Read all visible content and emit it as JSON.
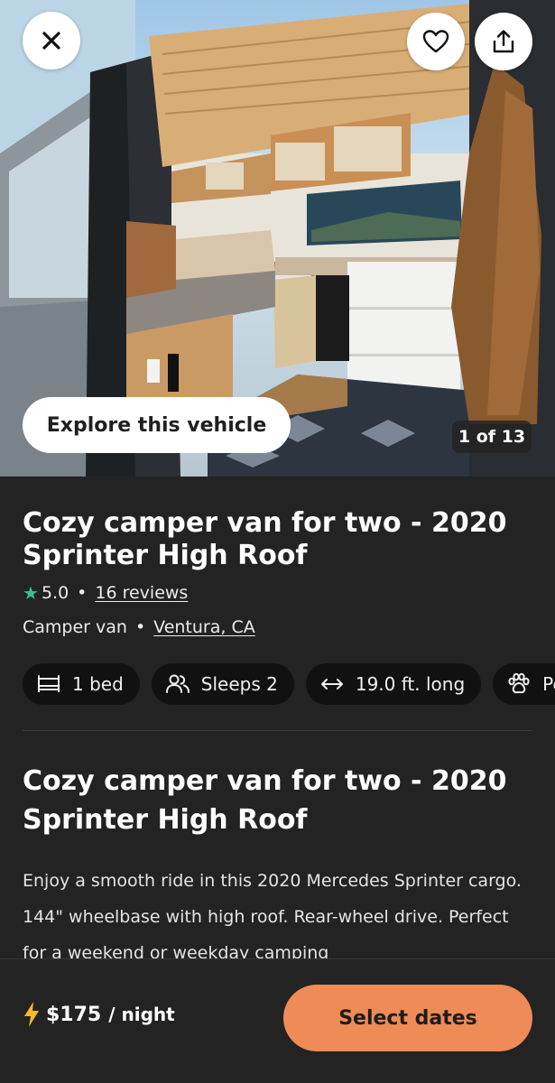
{
  "hero": {
    "explore_label": "Explore this vehicle",
    "photo_counter": "1 of 13",
    "icons": {
      "close": "close-icon",
      "favorite": "heart-icon",
      "share": "share-icon"
    }
  },
  "listing": {
    "title": "Cozy camper van for two - 2020 Sprinter High Roof",
    "rating": "5.0",
    "reviews": "16 reviews",
    "vehicle_type": "Camper van",
    "location": "Ventura, CA",
    "features": [
      {
        "icon": "bed-icon",
        "label": "1 bed"
      },
      {
        "icon": "people-icon",
        "label": "Sleeps 2"
      },
      {
        "icon": "length-arrows-icon",
        "label": "19.0 ft. long"
      },
      {
        "icon": "paw-icon",
        "label": "Pe"
      }
    ],
    "section_title": "Cozy camper van for two - 2020 Sprinter High Roof",
    "description": "Enjoy a smooth ride in this 2020 Mercedes Sprinter cargo. 144\" wheelbase with high roof. Rear-wheel drive. Perfect for a weekend or weekday camping"
  },
  "booking": {
    "price": "$175",
    "per": "/ night",
    "cta": "Select dates"
  },
  "colors": {
    "background": "#232323",
    "accent": "#ee8b57",
    "star": "#3fc08a",
    "lightning": "#f5b82e"
  }
}
